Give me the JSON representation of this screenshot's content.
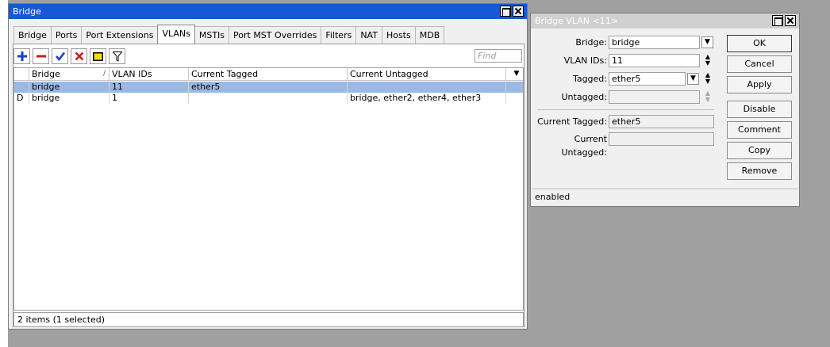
{
  "main_window": {
    "title": "Bridge",
    "tabs": [
      {
        "label": "Bridge"
      },
      {
        "label": "Ports"
      },
      {
        "label": "Port Extensions"
      },
      {
        "label": "VLANs"
      },
      {
        "label": "MSTIs"
      },
      {
        "label": "Port MST Overrides"
      },
      {
        "label": "Filters"
      },
      {
        "label": "NAT"
      },
      {
        "label": "Hosts"
      },
      {
        "label": "MDB"
      }
    ],
    "active_tab": "VLANs",
    "toolbar": {
      "add_icon": "plus-icon",
      "remove_icon": "minus-icon",
      "enable_icon": "checkmark-icon",
      "disable_icon": "x-icon",
      "comment_icon": "note-icon",
      "filter_icon": "filter-icon",
      "find_placeholder": "Find"
    },
    "table": {
      "columns": [
        "Bridge",
        "VLAN IDs",
        "Current Tagged",
        "Current Untagged"
      ],
      "sort_marker": "/",
      "rows": [
        {
          "flag": "",
          "bridge": "bridge",
          "vlan_ids": "11",
          "current_tagged": "ether5",
          "current_untagged": "",
          "selected": true
        },
        {
          "flag": "D",
          "bridge": "bridge",
          "vlan_ids": "1",
          "current_tagged": "",
          "current_untagged": "bridge, ether2, ether4, ether3",
          "selected": false
        }
      ]
    },
    "status": "2 items (1 selected)"
  },
  "vlan_window": {
    "title": "Bridge VLAN <11>",
    "fields": {
      "bridge": {
        "label": "Bridge:",
        "value": "bridge"
      },
      "vlan_ids": {
        "label": "VLAN IDs:",
        "value": "11"
      },
      "tagged": {
        "label": "Tagged:",
        "value": "ether5"
      },
      "untagged": {
        "label": "Untagged:",
        "value": ""
      },
      "current_tagged": {
        "label": "Current Tagged:",
        "value": "ether5"
      },
      "current_untagged": {
        "label": "Current Untagged:",
        "value": ""
      }
    },
    "buttons": {
      "ok": "OK",
      "cancel": "Cancel",
      "apply": "Apply",
      "disable": "Disable",
      "comment": "Comment",
      "copy": "Copy",
      "remove": "Remove"
    },
    "status": "enabled"
  },
  "colors": {
    "title_active": "#1658d8",
    "title_inactive": "#d0d0d0",
    "selection": "#9ab9e4",
    "add": "#1a3fd0",
    "remove": "#c02020",
    "enable": "#1a3fd0",
    "disable": "#c02020",
    "comment": "#f0e000"
  }
}
